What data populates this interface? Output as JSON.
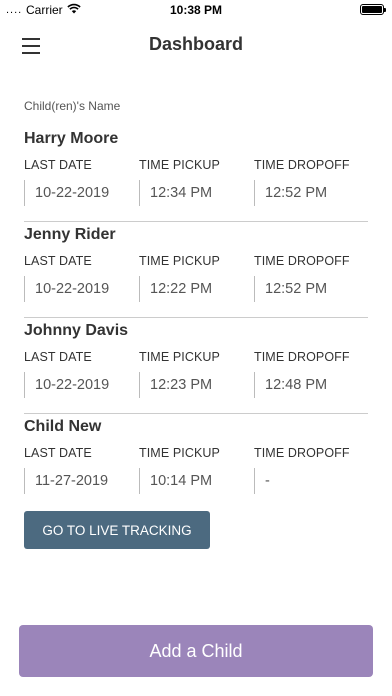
{
  "status_bar": {
    "signal": "....",
    "carrier": "Carrier",
    "time": "10:38 PM",
    "battery_level": 1.0
  },
  "header": {
    "title": "Dashboard",
    "menu_icon": "hamburger-menu-icon"
  },
  "section_label": "Child(ren)'s Name",
  "children": [
    {
      "name": "Harry Moore",
      "last_date_label": "LAST DATE",
      "pickup_label": "TIME PICKUP",
      "dropoff_label": "TIME DROPOFF",
      "last_date": "10-22-2019",
      "pickup": "12:34 PM",
      "dropoff": "12:52 PM"
    },
    {
      "name": "Jenny Rider",
      "last_date_label": "LAST DATE",
      "pickup_label": "TIME PICKUP",
      "dropoff_label": "TIME DROPOFF",
      "last_date": "10-22-2019",
      "pickup": "12:22 PM",
      "dropoff": "12:52 PM"
    },
    {
      "name": "Johnny Davis",
      "last_date_label": "LAST DATE",
      "pickup_label": "TIME PICKUP",
      "dropoff_label": "TIME DROPOFF",
      "last_date": "10-22-2019",
      "pickup": "12:23 PM",
      "dropoff": "12:48 PM"
    },
    {
      "name": "Child New",
      "last_date_label": "LAST DATE",
      "pickup_label": "TIME PICKUP",
      "dropoff_label": "TIME DROPOFF",
      "last_date": "11-27-2019",
      "pickup": "10:14 PM",
      "dropoff": "-"
    }
  ],
  "tracking_button": {
    "label": "GO TO LIVE TRACKING",
    "color": "#4c6a80"
  },
  "add_button": {
    "label": "Add a Child",
    "color": "#9b85ba"
  }
}
